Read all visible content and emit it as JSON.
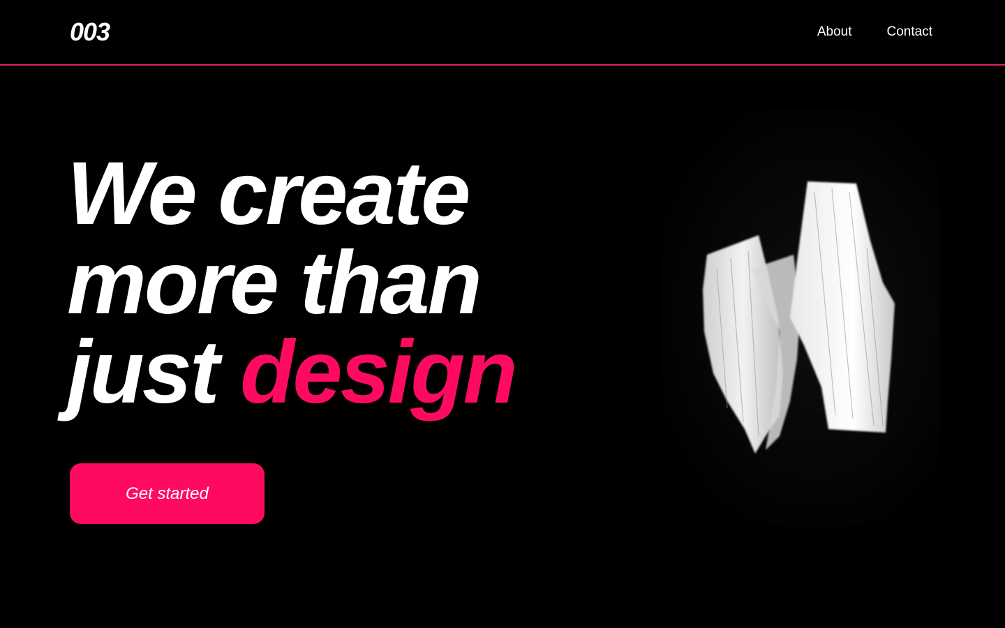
{
  "header": {
    "logo": "003",
    "nav": [
      {
        "label": "About"
      },
      {
        "label": "Contact"
      }
    ]
  },
  "hero": {
    "line1": "We create",
    "line2": "more than",
    "line3_plain": "just",
    "line3_accent": "design",
    "cta_label": "Get started"
  },
  "colors": {
    "background": "#000000",
    "accent": "#ff0a61",
    "divider": "#e0245e",
    "text": "#ffffff"
  },
  "media": {
    "icon": "white-brush-stroke-art"
  }
}
